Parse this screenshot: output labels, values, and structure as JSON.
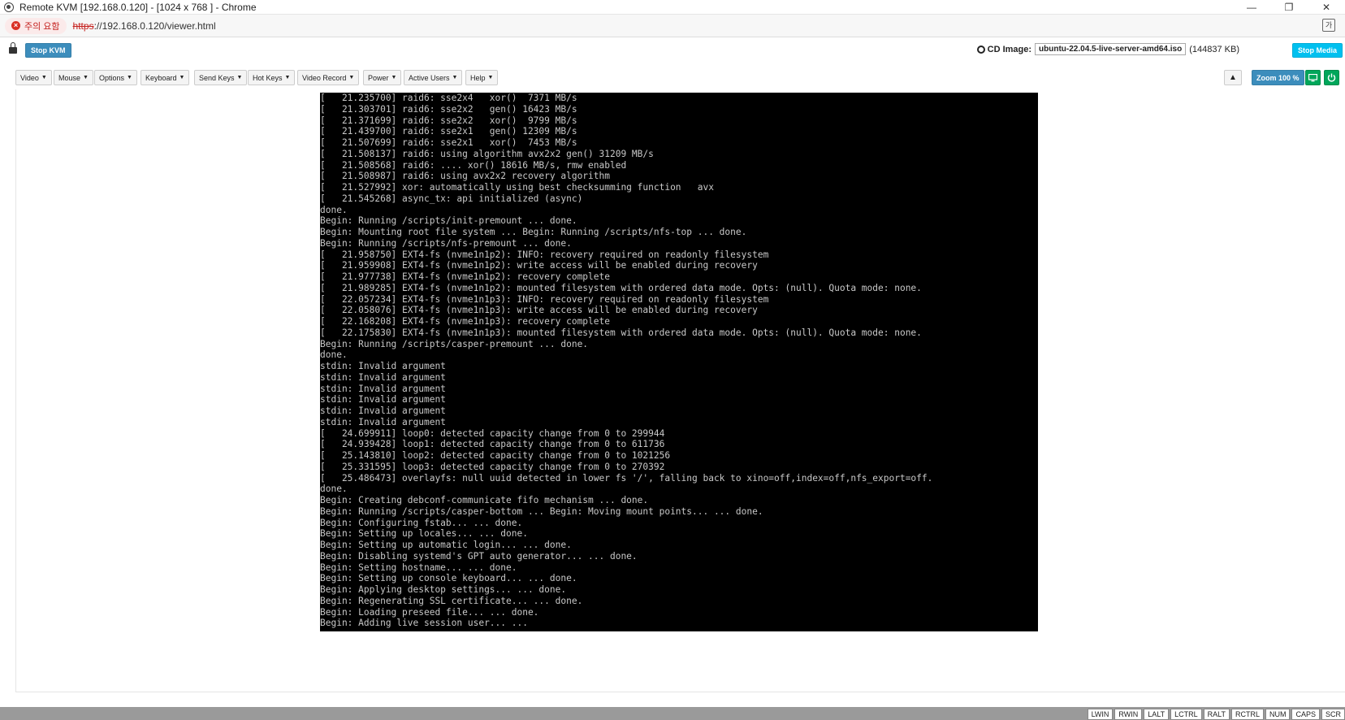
{
  "window": {
    "title": "Remote KVM [192.168.0.120] - [1024 x 768 ] - Chrome",
    "controls": [
      "—",
      "❐",
      "✕"
    ]
  },
  "address_bar": {
    "warning": "주의 요함",
    "url_scheme": "https",
    "url_rest": "://192.168.0.120/viewer.html"
  },
  "toolbar": {
    "stop_kvm": "Stop KVM",
    "cd_label": "CD Image:",
    "cd_file": "ubuntu-22.04.5-live-server-amd64.iso",
    "cd_size": "(144837 KB)",
    "stop_media": "Stop Media"
  },
  "menu": {
    "items": [
      {
        "label": "Video"
      },
      {
        "label": "Mouse"
      },
      {
        "label": "Options"
      },
      {
        "label": "Keyboard"
      },
      {
        "label": "Send Keys"
      },
      {
        "label": "Hot Keys"
      },
      {
        "label": "Video Record"
      },
      {
        "label": "Power"
      },
      {
        "label": "Active Users"
      },
      {
        "label": "Help"
      }
    ],
    "zoom": "Zoom 100 %"
  },
  "console": {
    "lines": [
      "[   21.235700] raid6: sse2x4   xor()  7371 MB/s",
      "[   21.303701] raid6: sse2x2   gen() 16423 MB/s",
      "[   21.371699] raid6: sse2x2   xor()  9799 MB/s",
      "[   21.439700] raid6: sse2x1   gen() 12309 MB/s",
      "[   21.507699] raid6: sse2x1   xor()  7453 MB/s",
      "[   21.508137] raid6: using algorithm avx2x2 gen() 31209 MB/s",
      "[   21.508568] raid6: .... xor() 18616 MB/s, rmw enabled",
      "[   21.508987] raid6: using avx2x2 recovery algorithm",
      "[   21.527992] xor: automatically using best checksumming function   avx",
      "[   21.545268] async_tx: api initialized (async)",
      "done.",
      "Begin: Running /scripts/init-premount ... done.",
      "Begin: Mounting root file system ... Begin: Running /scripts/nfs-top ... done.",
      "Begin: Running /scripts/nfs-premount ... done.",
      "[   21.958750] EXT4-fs (nvme1n1p2): INFO: recovery required on readonly filesystem",
      "[   21.959908] EXT4-fs (nvme1n1p2): write access will be enabled during recovery",
      "[   21.977738] EXT4-fs (nvme1n1p2): recovery complete",
      "[   21.989285] EXT4-fs (nvme1n1p2): mounted filesystem with ordered data mode. Opts: (null). Quota mode: none.",
      "[   22.057234] EXT4-fs (nvme1n1p3): INFO: recovery required on readonly filesystem",
      "[   22.058076] EXT4-fs (nvme1n1p3): write access will be enabled during recovery",
      "[   22.168208] EXT4-fs (nvme1n1p3): recovery complete",
      "[   22.175830] EXT4-fs (nvme1n1p3): mounted filesystem with ordered data mode. Opts: (null). Quota mode: none.",
      "Begin: Running /scripts/casper-premount ... done.",
      "done.",
      "stdin: Invalid argument",
      "stdin: Invalid argument",
      "stdin: Invalid argument",
      "stdin: Invalid argument",
      "stdin: Invalid argument",
      "stdin: Invalid argument",
      "[   24.699911] loop0: detected capacity change from 0 to 299944",
      "[   24.939428] loop1: detected capacity change from 0 to 611736",
      "[   25.143810] loop2: detected capacity change from 0 to 1021256",
      "[   25.331595] loop3: detected capacity change from 0 to 270392",
      "[   25.486473] overlayfs: null uuid detected in lower fs '/', falling back to xino=off,index=off,nfs_export=off.",
      "done.",
      "Begin: Creating debconf-communicate fifo mechanism ... done.",
      "Begin: Running /scripts/casper-bottom ... Begin: Moving mount points... ... done.",
      "Begin: Configuring fstab... ... done.",
      "Begin: Setting up locales... ... done.",
      "Begin: Setting up automatic login... ... done.",
      "Begin: Disabling systemd's GPT auto generator... ... done.",
      "Begin: Setting hostname... ... done.",
      "Begin: Setting up console keyboard... ... done.",
      "Begin: Applying desktop settings... ... done.",
      "Begin: Regenerating SSL certificate... ... done.",
      "Begin: Loading preseed file... ... done.",
      "Begin: Adding live session user... ..."
    ]
  },
  "status_keys": [
    "LWIN",
    "RWIN",
    "LALT",
    "LCTRL",
    "RALT",
    "RCTRL",
    "NUM",
    "CAPS",
    "SCR"
  ],
  "colors": {
    "primary": "#3c8dbc",
    "info": "#00c0ef",
    "success": "#00a65a",
    "console_bg": "#000000",
    "console_fg": "#c8c8c8"
  },
  "icons": [
    "app-icon",
    "warning-x-icon",
    "translate-icon",
    "lock-icon",
    "cd-icon",
    "warning-triangle-icon",
    "monitor-icon",
    "power-icon"
  ]
}
